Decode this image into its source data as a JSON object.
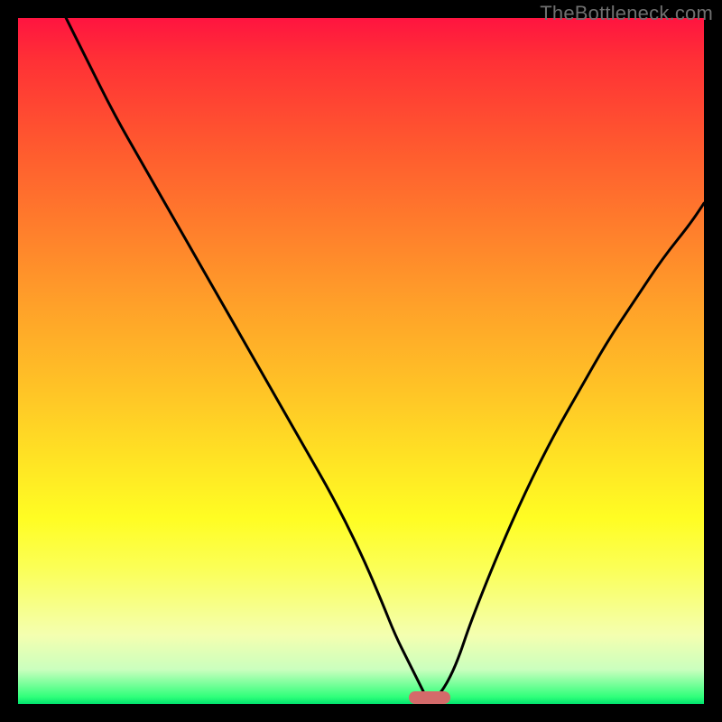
{
  "watermark": "TheBottleneck.com",
  "colors": {
    "frame": "#000000",
    "watermark_text": "#6f6f6f",
    "curve_stroke": "#000000",
    "marker_fill": "#d46a6a",
    "gradient_stops": [
      "#ff1440",
      "#ff3036",
      "#ff572f",
      "#ff7c2c",
      "#ffa129",
      "#ffc626",
      "#ffe524",
      "#fffd23",
      "#fbff55",
      "#f4ffb0",
      "#caffbe",
      "#2fff7a",
      "#00e36e"
    ]
  },
  "chart_data": {
    "type": "line",
    "title": "",
    "xlabel": "",
    "ylabel": "",
    "xlim": [
      0,
      100
    ],
    "ylim": [
      0,
      100
    ],
    "grid": false,
    "legend": false,
    "series": [
      {
        "name": "bottleneck-curve",
        "x": [
          7,
          10,
          14,
          18,
          22,
          26,
          30,
          34,
          38,
          42,
          46,
          50,
          53,
          55,
          57,
          59,
          60,
          62,
          64,
          66,
          70,
          74,
          78,
          82,
          86,
          90,
          94,
          98,
          100
        ],
        "y": [
          100,
          94,
          86,
          79,
          72,
          65,
          58,
          51,
          44,
          37,
          30,
          22,
          15,
          10,
          6,
          2,
          0,
          2,
          6,
          12,
          22,
          31,
          39,
          46,
          53,
          59,
          65,
          70,
          73
        ]
      }
    ],
    "annotations": [
      {
        "name": "optimal-marker",
        "x": 60,
        "y": 0,
        "shape": "pill",
        "color": "#d46a6a"
      }
    ]
  }
}
